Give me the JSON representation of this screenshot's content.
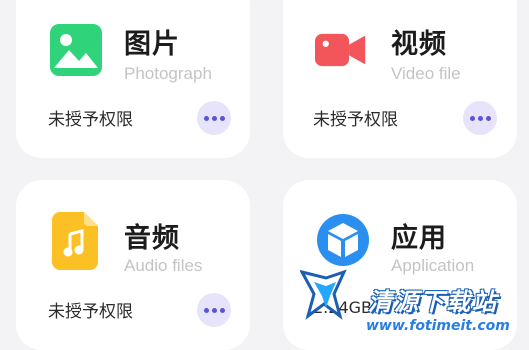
{
  "cards": [
    {
      "title": "图片",
      "subtitle": "Photograph",
      "status": "未授予权限",
      "icon": "photo-icon",
      "color": "#2fd37a"
    },
    {
      "title": "视频",
      "subtitle": "Video file",
      "status": "未授予权限",
      "icon": "video-icon",
      "color": "#f2565a"
    },
    {
      "title": "音频",
      "subtitle": "Audio files",
      "status": "未授予权限",
      "icon": "audio-file-icon",
      "color": "#fbc124"
    },
    {
      "title": "应用",
      "subtitle": "Application",
      "status": "2.24GB",
      "icon": "app-cube-icon",
      "color": "#2b8ff0"
    }
  ],
  "more_icon": "more-dots-icon",
  "watermark": {
    "text": "清源下载站",
    "url": "www.fotimeit.com",
    "logo": "watermark-logo"
  }
}
